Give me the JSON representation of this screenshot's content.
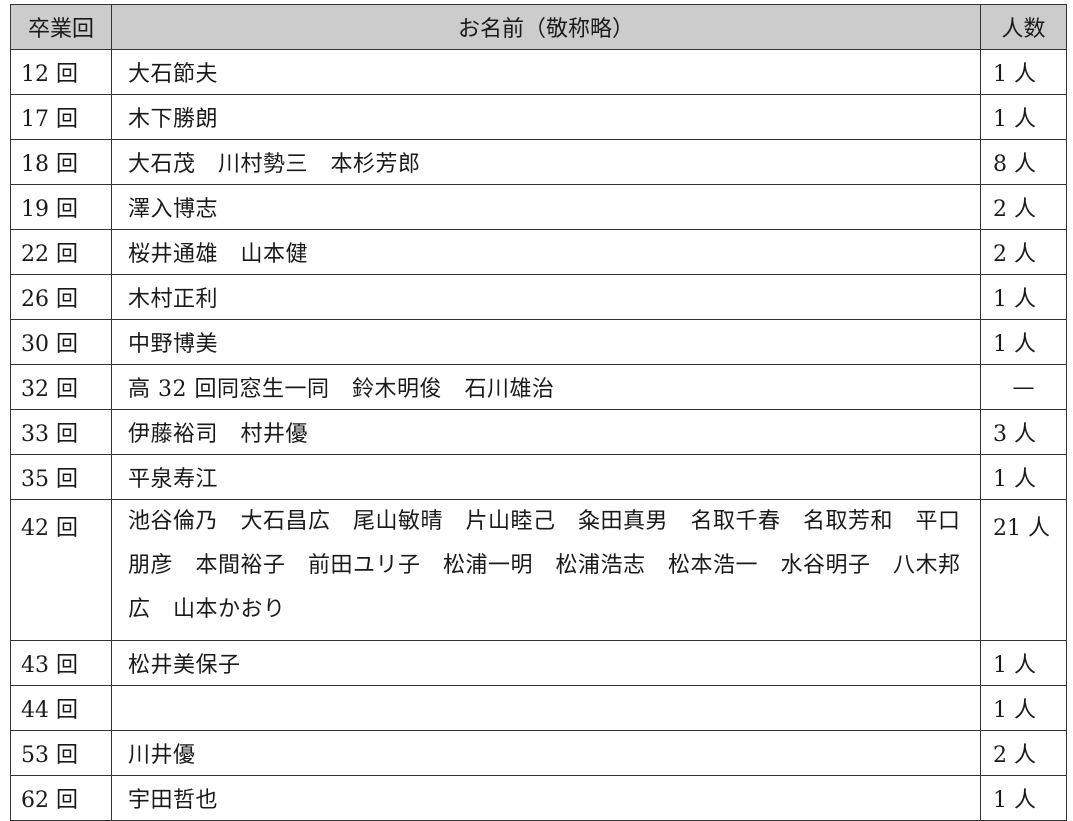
{
  "table": {
    "headers": [
      "卒業回",
      "お名前（敬称略）",
      "人数"
    ],
    "rows": [
      {
        "year": "12 回",
        "names": "大石節夫",
        "count": "1 人"
      },
      {
        "year": "17 回",
        "names": "木下勝朗",
        "count": "1 人"
      },
      {
        "year": "18 回",
        "names": "大石茂　川村勢三　本杉芳郎",
        "count": "8 人"
      },
      {
        "year": "19 回",
        "names": "澤入博志",
        "count": "2 人"
      },
      {
        "year": "22 回",
        "names": "桜井通雄　山本健",
        "count": "2 人"
      },
      {
        "year": "26 回",
        "names": "木村正利",
        "count": "1 人"
      },
      {
        "year": "30 回",
        "names": "中野博美",
        "count": "1 人"
      },
      {
        "year": "32 回",
        "names": "高 32 回同窓生一同　鈴木明俊　石川雄治",
        "count": "—"
      },
      {
        "year": "33 回",
        "names": "伊藤裕司　村井優",
        "count": "3 人"
      },
      {
        "year": "35 回",
        "names": "平泉寿江",
        "count": "1 人"
      },
      {
        "year": "42 回",
        "names": "池谷倫乃　大石昌広　尾山敏晴　片山睦己　粂田真男　名取千春　名取芳和　平口朋彦　本間裕子　前田ユリ子　松浦一明　松浦浩志　松本浩一　水谷明子　八木邦広　山本かおり",
        "count": "21 人"
      },
      {
        "year": "43 回",
        "names": "松井美保子",
        "count": "1 人"
      },
      {
        "year": "44 回",
        "names": "",
        "count": "1 人"
      },
      {
        "year": "53 回",
        "names": "川井優",
        "count": "2 人"
      },
      {
        "year": "62 回",
        "names": "宇田哲也",
        "count": "1 人"
      }
    ]
  }
}
